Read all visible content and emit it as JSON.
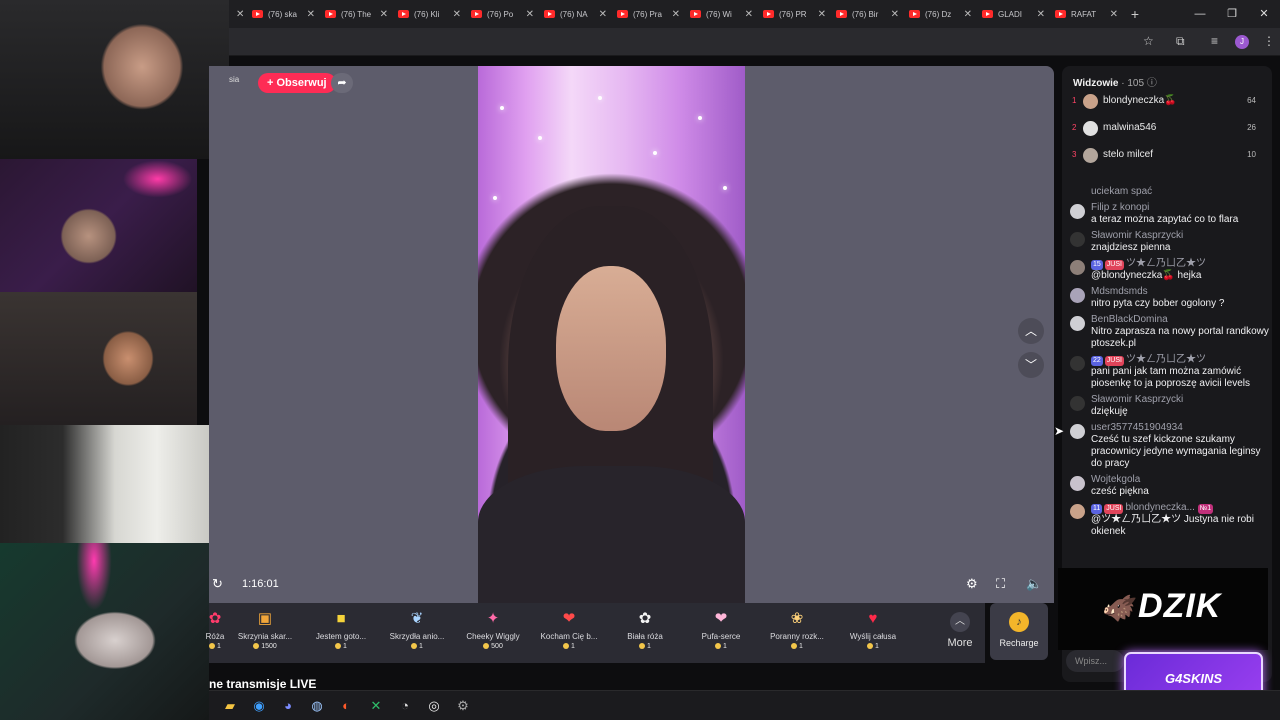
{
  "browser": {
    "tabs": [
      "(76) ska",
      "(76) The",
      "(76) Kli",
      "(76) Po",
      "(76) NA",
      "(76) Pra",
      "(76) Wi",
      "(76) PR",
      "(76) Bir",
      "(76) Dz",
      "GLADI",
      "RAFAT"
    ],
    "new_tab": "+"
  },
  "stream": {
    "channel_name_fragment": "sia",
    "follow_label": "+ Obserwuj",
    "elapsed_time": "1:16:01",
    "live_title_fragment": "ne transmisje LIVE"
  },
  "gifts": [
    {
      "name": "Róża",
      "price": "1"
    },
    {
      "name": "Skrzynia skar...",
      "price": "1500"
    },
    {
      "name": "Jestem goto...",
      "price": "1"
    },
    {
      "name": "Skrzydła anio...",
      "price": "1"
    },
    {
      "name": "Cheeky Wiggly",
      "price": "500"
    },
    {
      "name": "Kocham Cię b...",
      "price": "1"
    },
    {
      "name": "Biała róża",
      "price": "1"
    },
    {
      "name": "Pufa-serce",
      "price": "1"
    },
    {
      "name": "Poranny rozk...",
      "price": "1"
    },
    {
      "name": "Wyślij całusa",
      "price": "1"
    }
  ],
  "more_label": "More",
  "recharge_label": "Recharge",
  "viewers": {
    "title": "Widzowie",
    "count": "· 105",
    "top": [
      {
        "rank": "1",
        "name": "blondyneczka🍒",
        "score": "64"
      },
      {
        "rank": "2",
        "name": "malwina546",
        "score": "26"
      },
      {
        "rank": "3",
        "name": "stelo milcef",
        "score": "10"
      }
    ]
  },
  "chat": [
    {
      "user": "",
      "text": "uciekam spać"
    },
    {
      "user": "Filip z konopi",
      "text": "a teraz można zapytać co to flara"
    },
    {
      "user": "Sławomir Kasprzycki",
      "text": "znajdziesz pienna"
    },
    {
      "user": "ツ★ㄥ乃ㄩ乙★ツ",
      "badges": [
        "15",
        "JUSI"
      ],
      "text": "@blondyneczka🍒 hejka"
    },
    {
      "user": "Mdsmdsmds",
      "text": "nitro pyta czy bober ogolony ?"
    },
    {
      "user": "BenBlackDomina",
      "text": "Nitro zaprasza na nowy portal randkowy ptoszek.pl"
    },
    {
      "user": "ツ★ㄥ乃ㄩ乙★ツ",
      "badges": [
        "22",
        "JUSI"
      ],
      "text": "pani pani jak tam można zamówić piosenkę to ja poproszę avicii levels"
    },
    {
      "user": "Sławomir Kasprzycki",
      "text": "dziękuję"
    },
    {
      "user": "user3577451904934",
      "text": "Cześć tu szef kickzone szukamy pracownicy jedyne wymagania leginsy do pracy"
    },
    {
      "user": "Wojtekgola",
      "text": "cześć piękna"
    },
    {
      "user": "blondyneczka...",
      "badges": [
        "11",
        "JUSI",
        "№1"
      ],
      "text": "@ツ★ㄥ乃ㄩ乙★ツ Justyna nie robi okienek"
    }
  ],
  "chat_input_placeholder": "Wpisz...",
  "sponsor_main": "DZIK",
  "sponsor_secondary": "G4SKINS",
  "colors": {
    "accent": "#fe2c55",
    "coin": "#f3c64a",
    "panel": "#19191c"
  }
}
